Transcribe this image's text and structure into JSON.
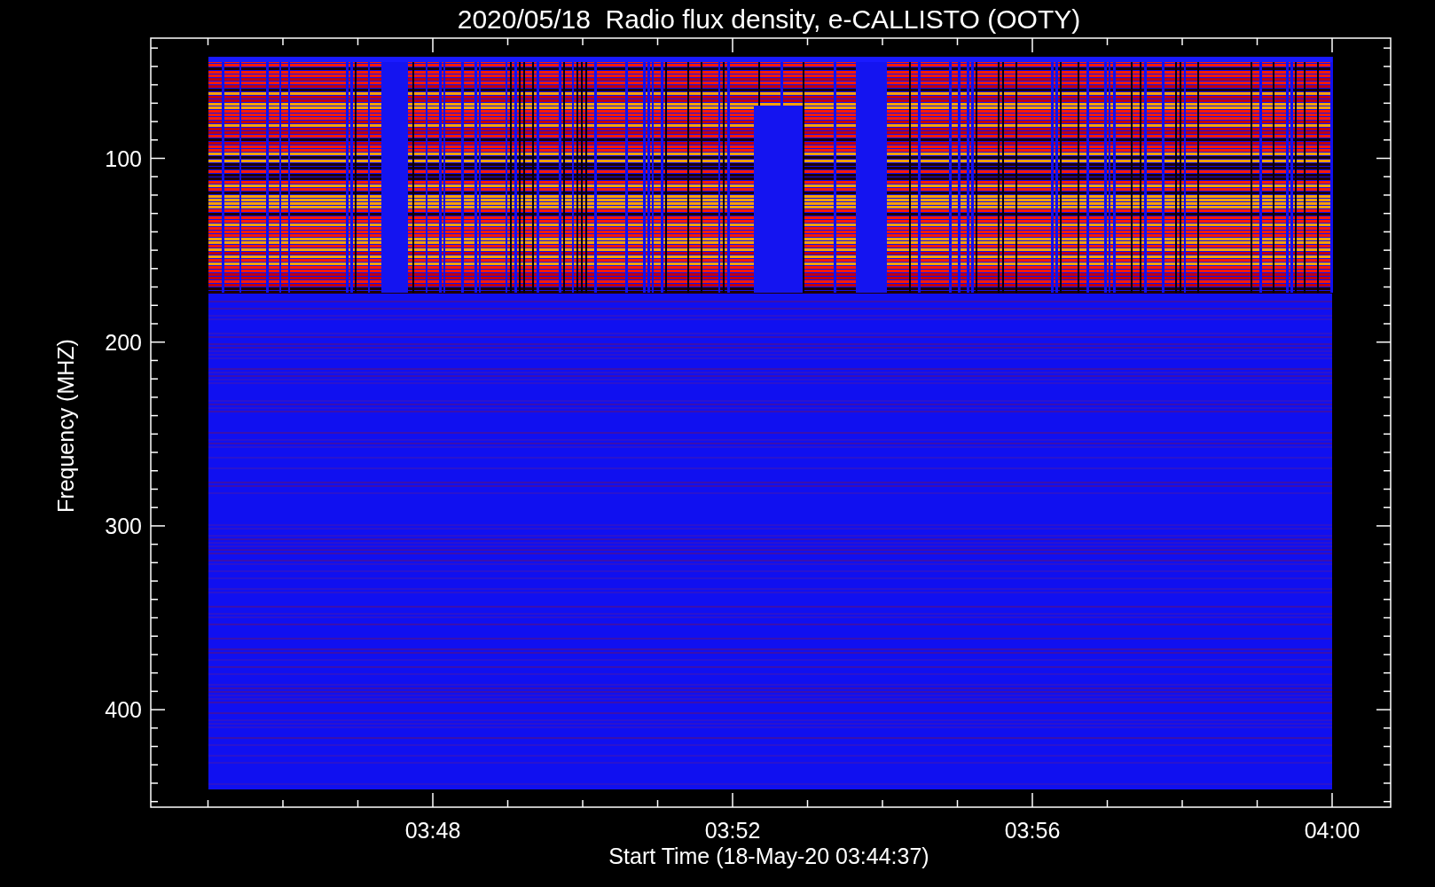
{
  "title": "2020/05/18  Radio flux density, e-CALLISTO (OOTY)",
  "plot": {
    "y_axis": {
      "label": "Frequency (MHZ)",
      "ticks": [
        "100",
        "200",
        "300",
        "400"
      ]
    },
    "x_axis": {
      "label": "Start Time (18-May-20 03:44:37)",
      "ticks": [
        "03:48",
        "03:52",
        "03:56",
        "04:00"
      ]
    }
  }
}
